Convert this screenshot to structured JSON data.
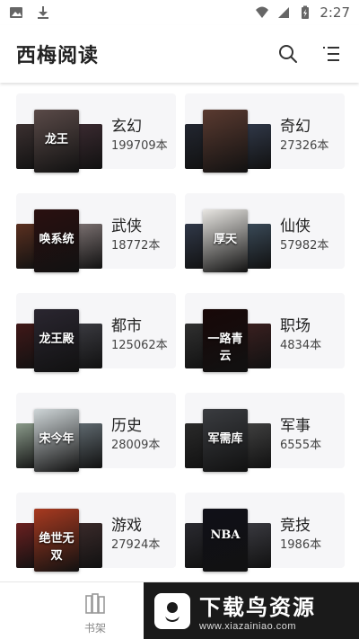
{
  "status": {
    "time": "2:27",
    "icons": [
      "image-icon",
      "download-icon",
      "wifi-icon",
      "signal-icon",
      "battery-charging-icon"
    ]
  },
  "appbar": {
    "title": "西梅阅读",
    "icons": [
      "search-icon",
      "menu-list-icon"
    ]
  },
  "categories": [
    {
      "name": "玄幻",
      "count": "199709本",
      "covers": {
        "left": "#3b3030",
        "front": "#5a4a48",
        "right": "#3a2a30",
        "front_text": "龙王"
      }
    },
    {
      "name": "奇幻",
      "count": "27326本",
      "covers": {
        "left": "#222630",
        "front": "#5a3a30",
        "right": "#303848",
        "front_text": ""
      }
    },
    {
      "name": "武侠",
      "count": "18772本",
      "covers": {
        "left": "#5a3020",
        "front": "#2a1010",
        "right": "#7a7070",
        "front_text": "唤系统"
      }
    },
    {
      "name": "仙侠",
      "count": "57982本",
      "covers": {
        "left": "#303848",
        "front": "#e8e6e2",
        "right": "#3a4a58",
        "front_text": "厚天"
      }
    },
    {
      "name": "都市",
      "count": "125062本",
      "covers": {
        "left": "#401818",
        "front": "#2a2630",
        "right": "#3a3a40",
        "front_text": "龙王殿"
      }
    },
    {
      "name": "职场",
      "count": "4834本",
      "covers": {
        "left": "#303030",
        "front": "#180808",
        "right": "#3a2020",
        "front_text": "一路青云"
      }
    },
    {
      "name": "历史",
      "count": "28009本",
      "covers": {
        "left": "#8a9a8a",
        "front": "#cfd6d8",
        "right": "#606a70",
        "front_text": "宋今年"
      }
    },
    {
      "name": "军事",
      "count": "6555本",
      "covers": {
        "left": "#2a2a2a",
        "front": "#3a3c40",
        "right": "#404040",
        "front_text": "军需库"
      }
    },
    {
      "name": "游戏",
      "count": "27924本",
      "covers": {
        "left": "#6a2020",
        "front": "#a83a20",
        "right": "#3a2a2a",
        "front_text": "绝世无双"
      }
    },
    {
      "name": "竞技",
      "count": "1986本",
      "covers": {
        "left": "#2a2a30",
        "front": "#101018",
        "right": "#3a3a40",
        "front_text": "NBA"
      }
    }
  ],
  "bottombar": {
    "tab_shelf_label": "书架"
  },
  "watermark": {
    "title": "下载鸟资源",
    "url": "www.xiazainiao.com"
  }
}
